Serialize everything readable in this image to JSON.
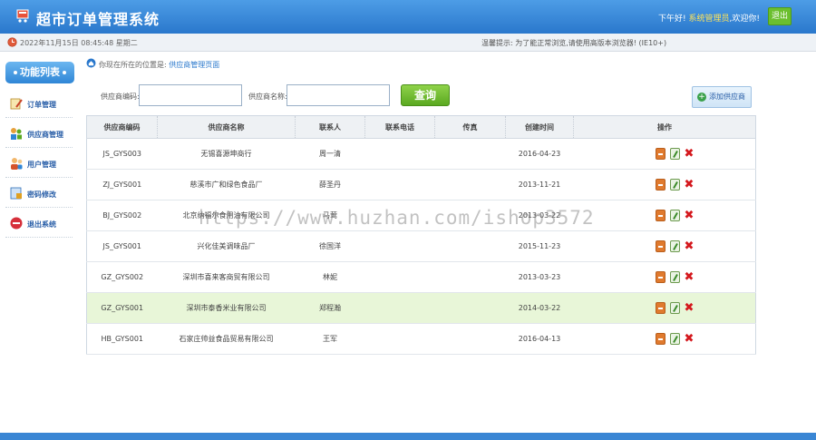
{
  "header": {
    "title": "超市订单管理系统",
    "greeting": "下午好!",
    "user": "系统管理员",
    "welcome": ",欢迎你!",
    "logout_label": "退出"
  },
  "infobar": {
    "datetime": "2022年11月15日 08:45:48 星期二",
    "tip": "温馨提示: 为了能正常浏览,请使用高版本浏览器! (IE10+)"
  },
  "sidebar": {
    "title": "功能列表",
    "items": [
      {
        "label": "订单管理",
        "icon": "order-icon"
      },
      {
        "label": "供应商管理",
        "icon": "supplier-icon"
      },
      {
        "label": "用户管理",
        "icon": "user-icon"
      },
      {
        "label": "密码修改",
        "icon": "password-icon"
      },
      {
        "label": "退出系统",
        "icon": "exit-icon"
      }
    ]
  },
  "breadcrumb": {
    "prefix": "你现在所在的位置是:",
    "location": "供应商管理页面"
  },
  "search": {
    "code_label": "供应商编码:",
    "code_value": "",
    "name_label": "供应商名称:",
    "name_value": "",
    "query_label": "查询",
    "add_label": "添加供应商"
  },
  "table": {
    "headers": [
      "供应商编码",
      "供应商名称",
      "联系人",
      "联系电话",
      "传真",
      "创建时间",
      "操作"
    ],
    "rows": [
      {
        "code": "JS_GYS003",
        "name": "无锡喜源坤商行",
        "contact": "周一清",
        "phone": "",
        "fax": "",
        "created": "2016-04-23"
      },
      {
        "code": "ZJ_GYS001",
        "name": "慈溪市广和绿色食品厂",
        "contact": "薛圣丹",
        "phone": "",
        "fax": "",
        "created": "2013-11-21"
      },
      {
        "code": "BJ_GYS002",
        "name": "北京纳福尔食用油有限公司",
        "contact": "马莺",
        "phone": "",
        "fax": "",
        "created": "2013-03-22"
      },
      {
        "code": "JS_GYS001",
        "name": "兴化佳美调味品厂",
        "contact": "徐国洋",
        "phone": "",
        "fax": "",
        "created": "2015-11-23"
      },
      {
        "code": "GZ_GYS002",
        "name": "深圳市喜来客商贸有限公司",
        "contact": "林妮",
        "phone": "",
        "fax": "",
        "created": "2013-03-23"
      },
      {
        "code": "GZ_GYS001",
        "name": "深圳市泰香米业有限公司",
        "contact": "郑程瀚",
        "phone": "",
        "fax": "",
        "created": "2014-03-22"
      },
      {
        "code": "HB_GYS001",
        "name": "石家庄帅益食品贸易有限公司",
        "contact": "王军",
        "phone": "",
        "fax": "",
        "created": "2016-04-13"
      }
    ]
  },
  "watermark": "https://www.huzhan.com/ishop3572",
  "colors": {
    "header": "#2a78cc",
    "query_button": "#6bbf2e",
    "highlight_row": "#e8f6d8",
    "delete": "#d4181d"
  }
}
